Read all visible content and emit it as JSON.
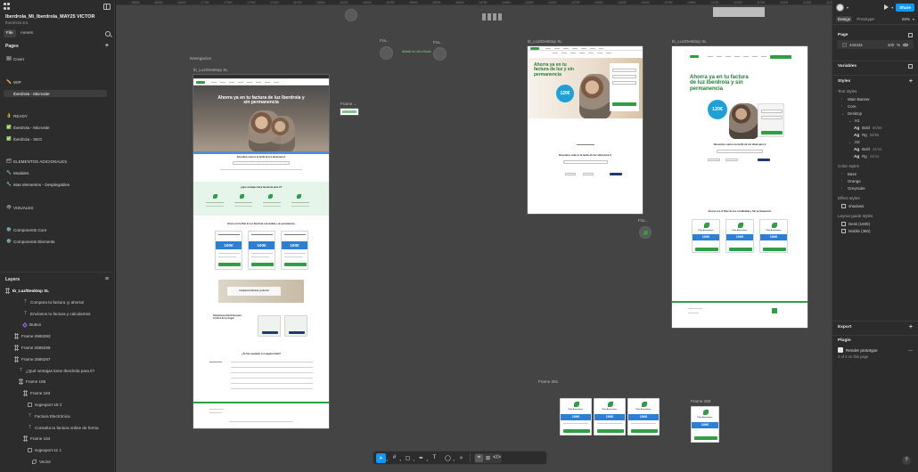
{
  "file": {
    "name": "Iberdrola_Mi_Iberdrola_MAY25 VICTOR",
    "team": "Iberdrola ES",
    "tabs": [
      "File",
      "Assets"
    ]
  },
  "pages": {
    "title": "Pages",
    "items": [
      {
        "label": "Cover",
        "icon": "🖼",
        "top": 0
      },
      {
        "label": "WIP",
        "icon": "✏️"
      },
      {
        "label": "Iberdrola - Microsite",
        "icon": "",
        "selected": true
      },
      {
        "label": "READY",
        "icon": "👌"
      },
      {
        "label": "Iberdrola - Microsite",
        "icon": "✅"
      },
      {
        "label": "Iberdrola - SEO",
        "icon": "✅"
      },
      {
        "label": "ELEMENTOS ADICIONALES",
        "icon": "🗂"
      },
      {
        "label": "Modales",
        "icon": "🔧"
      },
      {
        "label": "Mas elementos - Desplegables",
        "icon": "🔧"
      },
      {
        "label": "VISUALES",
        "icon": "👁"
      },
      {
        "label": "Components Core",
        "icon": "⚙️"
      },
      {
        "label": "Components Elements",
        "icon": "⚙️"
      }
    ]
  },
  "layers": {
    "title": "Layers",
    "items": [
      {
        "label": "Ib_Luz/Desktop XL",
        "type": "frame",
        "indent": 0,
        "bold": true
      },
      {
        "label": "Compara tu factura ¡y ahorra!",
        "type": "text",
        "indent": 4
      },
      {
        "label": "Envíanos tu factura y calculamos",
        "type": "text",
        "indent": 4
      },
      {
        "label": "Button",
        "type": "comp",
        "indent": 4
      },
      {
        "label": "Frame 2686393",
        "type": "frame",
        "indent": 2
      },
      {
        "label": "Frame 2686299",
        "type": "frame",
        "indent": 2
      },
      {
        "label": "Frame 2686297",
        "type": "frame",
        "indent": 2
      },
      {
        "label": "¿Qué ventajas tiene Iberdrola para ti?",
        "type": "text",
        "indent": 3
      },
      {
        "label": "Frame 185",
        "type": "frame",
        "indent": 3
      },
      {
        "label": "Frame 183",
        "type": "frame",
        "indent": 4
      },
      {
        "label": "svgexport-18 2",
        "type": "grp",
        "indent": 5
      },
      {
        "label": "Factura Electrónica",
        "type": "text",
        "indent": 5
      },
      {
        "label": "Consulta tu factura online de forma",
        "type": "text",
        "indent": 5
      },
      {
        "label": "Frame 184",
        "type": "frame",
        "indent": 4
      },
      {
        "label": "svgexport-11 1",
        "type": "grp",
        "indent": 5
      },
      {
        "label": "Vector",
        "type": "vec",
        "indent": 6
      }
    ]
  },
  "right_panel": {
    "share": "Share",
    "tabs": [
      "Design",
      "Prototype"
    ],
    "zoom": "26%",
    "page_title": "Page",
    "page_color": "444444",
    "page_opacity": "100",
    "page_opacity_unit": "%",
    "variables": "Variables",
    "styles": "Styles",
    "text_styles": "Text styles",
    "text_groups": [
      "Main Banner",
      "Core",
      "Desktop"
    ],
    "h1": "H1",
    "h2": "H2",
    "ag": "Ag",
    "text_entries": [
      {
        "name": "Bold",
        "meta": "56/56"
      },
      {
        "name": "Rg",
        "meta": "56/56"
      },
      {
        "name": "Bold",
        "meta": "44/44"
      },
      {
        "name": "Rg",
        "meta": "44/44"
      }
    ],
    "color_styles": "Color styles",
    "color_groups": [
      "Base",
      "Orange",
      "Greyscale"
    ],
    "effect_styles": "Effect styles",
    "effect_items": [
      "shadows"
    ],
    "layout_styles": "Layout guide styles",
    "layout_items": [
      "Desk (1600)",
      "Mobile (360)"
    ],
    "export": "Export",
    "plugin": "Plugin",
    "plugin_name": "Render prototype",
    "plugin_meta": "3 of 3 on this page",
    "help": "?"
  },
  "canvas": {
    "ruler_marks": [
      "-18500",
      "-18250",
      "-18000",
      "-17750",
      "-17500",
      "-17250",
      "-17000",
      "-16750",
      "-16500",
      "-16250",
      "-16000",
      "-15750",
      "-15500",
      "-15250",
      "-15000",
      "-14750",
      "-14500",
      "-14250",
      "-14000",
      "-13750",
      "-13500",
      "-13250",
      "-13000",
      "-12750",
      "-12500",
      "-12250",
      "-12000",
      "-11750",
      "-11500",
      "-11250",
      "-11000"
    ],
    "labels": {
      "navegacion": "Navegacion",
      "main_frame": "Ib_Luz/Desktop XL",
      "frame_small": "Frame ...",
      "fra1": "Fra...",
      "fra2": "Fra...",
      "green_note": "Añadir en otro Modo",
      "mid_frame": "Ib_Luz/Desktop XL",
      "right_frame": "Ib_Luz/Desktop XL",
      "fra3": "Fra...",
      "frame281": "Frame 281",
      "frame259": "Frame 259"
    },
    "site": {
      "hero_title_main": "Ahorra ya en tu factura de luz Iberdrola y sin permanencia",
      "hero_title_mid": "Ahorra ya en tu factura de luz y sin permanencia",
      "hero_title_right": "Ahorra ya en tu factura de luz Iberdrola y sin permanencia",
      "badge": "120€",
      "discover": "Descubre cuál es la tarifa de luz ideal para ti",
      "ventajas": "¿Qué ventajas tiene Iberdrola para ti?",
      "plan": "Ahorra con la Plan de Luz Iberdrola a la medida y sin permanencia.",
      "plan_right": "Ahorra con el Plan de Luz a la Medida y Sin permanencia.",
      "card_titles": [
        "Plan Online",
        "Plan Estable",
        "Plan Noche"
      ],
      "card_title_plain": "Plan Aracsiones",
      "card_price": "100€",
      "compara": "Compara tu factura ¡y ahorra!",
      "soluciones": "Soluciones Iberdrola para confort de tu hogar",
      "faq": "¿Te has quedado con alguna duda?"
    }
  },
  "toolbar": {
    "tools": [
      "move-tool",
      "frame-tool",
      "shape-tool",
      "pen-tool",
      "text-tool",
      "comment-tool",
      "actions-tool"
    ],
    "dev": "</>"
  }
}
